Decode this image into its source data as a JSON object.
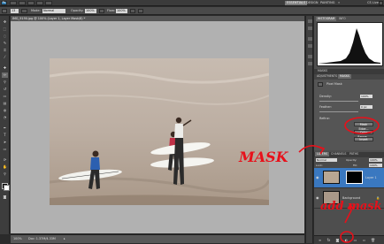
{
  "app": {
    "logo": "Ps",
    "workspaces": [
      "ESSENTIALS",
      "DESIGN",
      "PAINTING"
    ],
    "active_workspace": "ESSENTIALS",
    "cs_live": "CS Live"
  },
  "options_bar": {
    "brush_size": "13",
    "mode_label": "Mode:",
    "mode_value": "Normal",
    "opacity_label": "Opacity:",
    "opacity_value": "100%",
    "flow_label": "Flow:",
    "flow_value": "100%"
  },
  "document": {
    "tab_title": "IMG_9190.jpg @ 100% (Layer 1, Layer Mask/8) *",
    "zoom": "100%",
    "doc_info": "Doc: 1.37M/4.33M"
  },
  "panels": {
    "histogram_tab": "HISTOGRAM",
    "info_tab": "INFO",
    "masks_header": "MASKS",
    "adjustments_tab": "ADJUSTMENTS",
    "masks_tab": "MASKS",
    "mask_kind": "Pixel Mask",
    "density_label": "Density:",
    "density_value": "100%",
    "feather_label": "Feather:",
    "feather_value": "0 px",
    "refine_label": "Refine:",
    "mask_edge_button": "Mask Edge...",
    "color_range_button": "Color Range...",
    "invert_button": "Invert",
    "layers_tab": "LAYERS",
    "channels_tab": "CHANNELS",
    "paths_tab": "PATHS",
    "blend_mode": "Normal",
    "opacity_label": "Opacity:",
    "opacity_value": "100%",
    "lock_label": "Lock:",
    "fill_label": "Fill:",
    "fill_value": "100%",
    "layers": [
      {
        "name": "Layer 1"
      },
      {
        "name": "Background"
      }
    ]
  },
  "annotations": {
    "mask": "MASK",
    "add_mask": "add mask"
  },
  "colors": {
    "annotation_red": "#e8101a",
    "ui_dark": "#3b3b3b",
    "canvas_gray": "#b1b1b1"
  }
}
